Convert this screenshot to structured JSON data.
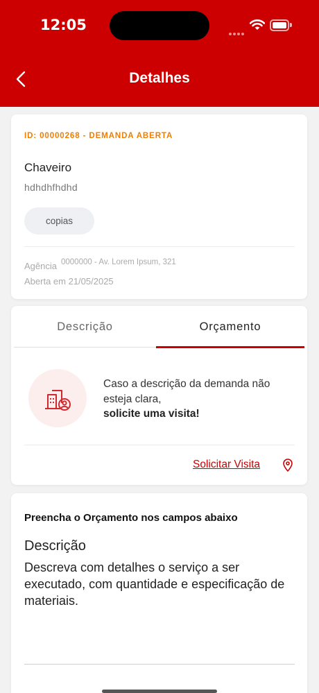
{
  "status_bar": {
    "time": "12:05"
  },
  "header": {
    "title": "Detalhes"
  },
  "demand": {
    "id_line": "ID: 00000268 - DEMANDA ABERTA",
    "service": "Chaveiro",
    "description": "hdhdhfhdhd",
    "tag": "copias",
    "agency_label": "Agência",
    "agency_value": "0000000 - Av. Lorem Ipsum, 321",
    "opened": "Aberta em 21/05/2025"
  },
  "tabs": [
    {
      "label": "Descrição",
      "active": false
    },
    {
      "label": "Orçamento",
      "active": true
    }
  ],
  "visit": {
    "line1": "Caso a descrição da demanda não",
    "line2": "esteja clara,",
    "line3": "solicite uma visita!",
    "link": "Solicitar Visita"
  },
  "form": {
    "heading": "Preencha o Orçamento nos campos abaixo",
    "field_label": "Descrição",
    "field_placeholder": "Descreva com detalhes o serviço a ser executado, com quantidade e especificação de materiais."
  },
  "colors": {
    "brand": "#cc0000",
    "accent": "#ef7d00",
    "visit_bg": "#fdeeee"
  },
  "icons": [
    "back-chevron-icon",
    "wifi-icon",
    "battery-icon",
    "building-person-icon",
    "location-pin-icon"
  ]
}
